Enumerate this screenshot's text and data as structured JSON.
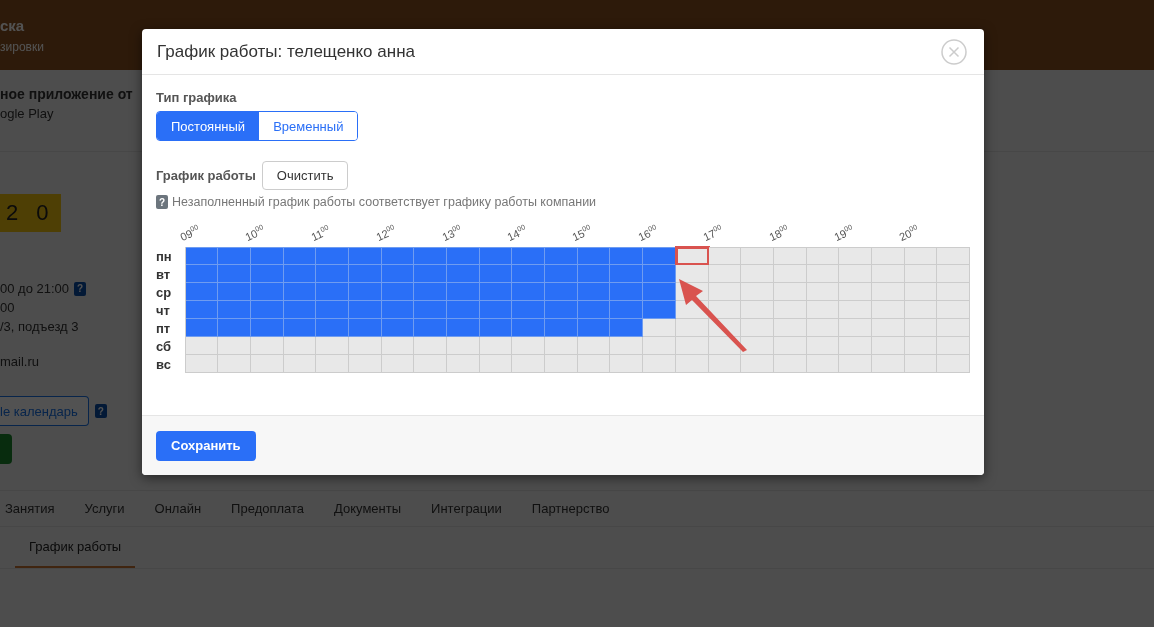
{
  "page": {
    "header": {
      "title": "ска",
      "subtitle": "зировки"
    },
    "app_banner": {
      "title": "ное приложение от",
      "subtitle": "ogle Play"
    },
    "code_badge": "2 0",
    "info_lines": [
      {
        "text": "00 до 21:00",
        "help": "?"
      },
      {
        "text": "00"
      },
      {
        "text": "/3, подъезд 3"
      },
      {
        "text": "mail.ru"
      }
    ],
    "calendar_button": "le календарь",
    "calendar_help": "?",
    "tabs": [
      {
        "label": "Занятия",
        "selected": false
      },
      {
        "label": "Услуги",
        "selected": false
      },
      {
        "label": "Онлайн",
        "selected": false
      },
      {
        "label": "Предоплата",
        "selected": false
      },
      {
        "label": "Документы",
        "selected": false
      },
      {
        "label": "Интеграции",
        "selected": false
      },
      {
        "label": "Партнерство",
        "selected": false
      }
    ],
    "subtabs": [
      {
        "label": "График работы",
        "selected": true
      }
    ]
  },
  "dialog": {
    "title": "График работы: телещенко анна",
    "schedule_type": {
      "label": "Тип графика",
      "options": [
        {
          "label": "Постоянный",
          "selected": true
        },
        {
          "label": "Временный",
          "selected": false
        }
      ]
    },
    "schedule_label": "График работы",
    "clear_button": "Очистить",
    "hint_icon": "?",
    "hint": "Незаполненный график работы соответствует графику работы компании",
    "hours": [
      {
        "hour": "09",
        "minutes": "00"
      },
      {
        "hour": "10",
        "minutes": "00"
      },
      {
        "hour": "11",
        "minutes": "00"
      },
      {
        "hour": "12",
        "minutes": "00"
      },
      {
        "hour": "13",
        "minutes": "00"
      },
      {
        "hour": "14",
        "minutes": "00"
      },
      {
        "hour": "15",
        "minutes": "00"
      },
      {
        "hour": "16",
        "minutes": "00"
      },
      {
        "hour": "17",
        "minutes": "00"
      },
      {
        "hour": "18",
        "minutes": "00"
      },
      {
        "hour": "19",
        "minutes": "00"
      },
      {
        "hour": "20",
        "minutes": "00"
      }
    ],
    "days": [
      {
        "day": "пн",
        "cells": [
          true,
          true,
          true,
          true,
          true,
          true,
          true,
          true,
          true,
          true,
          true,
          true,
          true,
          true,
          true,
          false,
          false,
          false,
          false,
          false,
          false,
          false,
          false,
          false
        ],
        "marked_cell": [
          false,
          false,
          false,
          false,
          false,
          false,
          false,
          false,
          false,
          false,
          false,
          false,
          false,
          false,
          false,
          true,
          false,
          false,
          false,
          false,
          false,
          false,
          false,
          false
        ]
      },
      {
        "day": "вт",
        "cells": [
          true,
          true,
          true,
          true,
          true,
          true,
          true,
          true,
          true,
          true,
          true,
          true,
          true,
          true,
          true,
          false,
          false,
          false,
          false,
          false,
          false,
          false,
          false,
          false
        ]
      },
      {
        "day": "ср",
        "cells": [
          true,
          true,
          true,
          true,
          true,
          true,
          true,
          true,
          true,
          true,
          true,
          true,
          true,
          true,
          true,
          false,
          false,
          false,
          false,
          false,
          false,
          false,
          false,
          false
        ]
      },
      {
        "day": "чт",
        "cells": [
          true,
          true,
          true,
          true,
          true,
          true,
          true,
          true,
          true,
          true,
          true,
          true,
          true,
          true,
          true,
          false,
          false,
          false,
          false,
          false,
          false,
          false,
          false,
          false
        ]
      },
      {
        "day": "пт",
        "cells": [
          true,
          true,
          true,
          true,
          true,
          true,
          true,
          true,
          true,
          true,
          true,
          true,
          true,
          true,
          false,
          false,
          false,
          false,
          false,
          false,
          false,
          false,
          false,
          false
        ]
      },
      {
        "day": "сб",
        "cells": [
          false,
          false,
          false,
          false,
          false,
          false,
          false,
          false,
          false,
          false,
          false,
          false,
          false,
          false,
          false,
          false,
          false,
          false,
          false,
          false,
          false,
          false,
          false,
          false
        ]
      },
      {
        "day": "вс",
        "cells": [
          false,
          false,
          false,
          false,
          false,
          false,
          false,
          false,
          false,
          false,
          false,
          false,
          false,
          false,
          false,
          false,
          false,
          false,
          false,
          false,
          false,
          false,
          false,
          false
        ]
      }
    ],
    "annotation_arrow": true,
    "save_button": "Сохранить"
  }
}
